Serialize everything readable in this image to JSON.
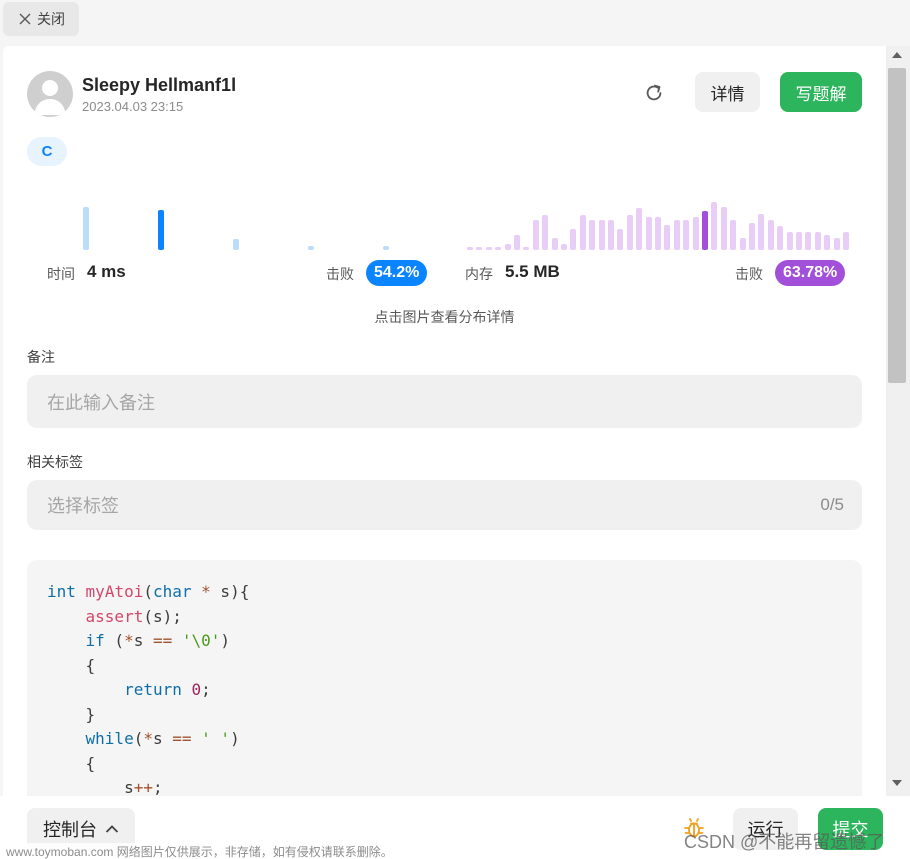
{
  "topbar": {
    "close_label": "关闭",
    "close_icon": "close-icon"
  },
  "header": {
    "username": "Sleepy Hellmanf1l",
    "timestamp": "2023.04.03 23:15",
    "details_label": "详情",
    "write_solution_label": "写题解"
  },
  "language_tag": "C",
  "stats": {
    "runtime_label": "时间",
    "runtime_value": "4 ms",
    "runtime_beat_label": "击败",
    "runtime_beat_value": "54.2%",
    "memory_label": "内存",
    "memory_value": "5.5 MB",
    "memory_beat_label": "击败",
    "memory_beat_value": "63.78%",
    "hint": "点击图片查看分布详情"
  },
  "colors": {
    "runtime_bar": "#bcdcfc",
    "runtime_bar_active": "#0a84ff",
    "memory_bar": "#e8cdf7",
    "memory_bar_active": "#a24fd9",
    "accent_green": "#2db55d"
  },
  "distribution": {
    "runtime": {
      "levels": [
        0.72,
        0.66,
        0.18,
        0.07,
        0.07
      ],
      "active_index": 1
    },
    "memory": {
      "levels": [
        0.05,
        0.05,
        0.05,
        0.05,
        0.1,
        0.25,
        0.05,
        0.5,
        0.58,
        0.2,
        0.1,
        0.35,
        0.58,
        0.5,
        0.5,
        0.5,
        0.35,
        0.58,
        0.7,
        0.55,
        0.55,
        0.42,
        0.5,
        0.5,
        0.55,
        0.65,
        0.8,
        0.72,
        0.5,
        0.2,
        0.45,
        0.6,
        0.5,
        0.4,
        0.3,
        0.3,
        0.3,
        0.3,
        0.25,
        0.2,
        0.3
      ],
      "active_index": 25
    }
  },
  "notes": {
    "label": "备注",
    "placeholder": "在此输入备注"
  },
  "tags": {
    "label": "相关标签",
    "placeholder": "选择标签",
    "count": "0/5"
  },
  "bottombar": {
    "console_label": "控制台",
    "run_label": "运行",
    "submit_label": "提交"
  },
  "watermark": {
    "left": "www.toymoban.com 网络图片仅供展示，非存储，如有侵权请联系删除。",
    "right": "CSDN @不能再留遗憾了"
  }
}
